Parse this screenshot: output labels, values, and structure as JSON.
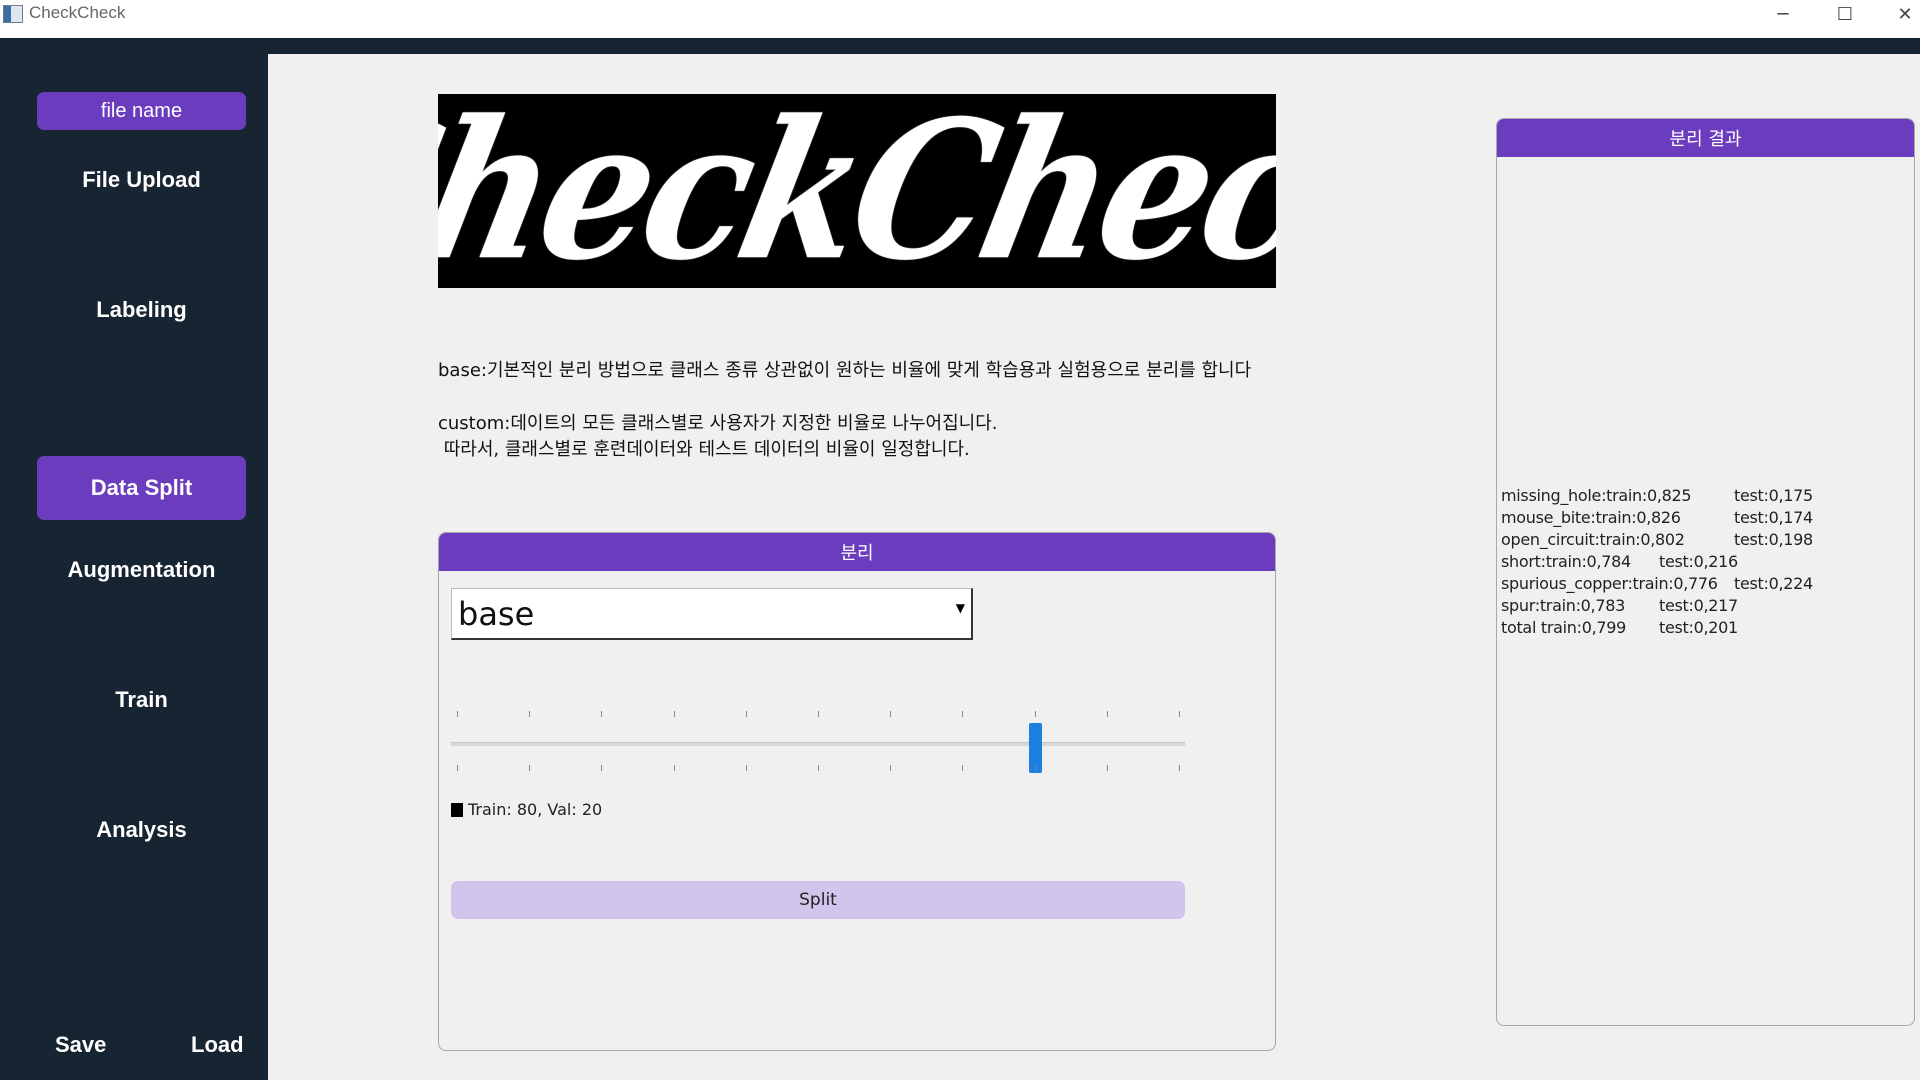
{
  "window": {
    "title": "CheckCheck",
    "min_glyph": "─",
    "max_glyph": "☐",
    "close_glyph": "✕"
  },
  "sidebar": {
    "file_name": "file name",
    "nav": [
      {
        "label": "File Upload",
        "active": false
      },
      {
        "label": "Labeling",
        "active": false
      },
      {
        "label": "Data Split",
        "active": true
      },
      {
        "label": "Augmentation",
        "active": false
      },
      {
        "label": "Train",
        "active": false
      },
      {
        "label": "Analysis",
        "active": false
      }
    ],
    "save_label": "Save",
    "load_label": "Load"
  },
  "logo": {
    "text": "CheckCheck"
  },
  "description": {
    "base": "base:기본적인 분리 방법으로 클래스 종류 상관없이 원하는 비율에 맞게 학습용과 실험용으로 분리를 합니다",
    "custom_line1": "custom:데이트의 모든 클래스별로 사용자가 지정한 비율로 나누어집니다.",
    "custom_line2": " 따라서, 클래스별로 훈련데이터와 테스트 데이터의 비율이 일정합니다."
  },
  "split_panel": {
    "header": "분리",
    "method_selected": "base",
    "slider": {
      "min": 0,
      "max": 100,
      "value": 80,
      "ticks": 11
    },
    "legend_text": "Train: 80, Val: 20",
    "split_button": "Split"
  },
  "result_panel": {
    "header": "분리 결과",
    "rows": [
      {
        "train": "missing_hole:train:0,825",
        "test": "test:0,175"
      },
      {
        "train": "mouse_bite:train:0,826",
        "test": "test:0,174"
      },
      {
        "train": "open_circuit:train:0,802",
        "test": "test:0,198"
      },
      {
        "train": "short:train:0,784",
        "test": "test:0,216"
      },
      {
        "train": "spurious_copper:train:0,776",
        "test": "test:0,224"
      },
      {
        "train": "spur:train:0,783",
        "test": "test:0,217"
      },
      {
        "train": "total train:0,799",
        "test": "test:0,201"
      }
    ]
  },
  "colors": {
    "sidebar_bg": "#172431",
    "accent": "#6c3cbf",
    "split_button_bg": "#d0c5ea",
    "slider_handle": "#1a7fe0"
  }
}
